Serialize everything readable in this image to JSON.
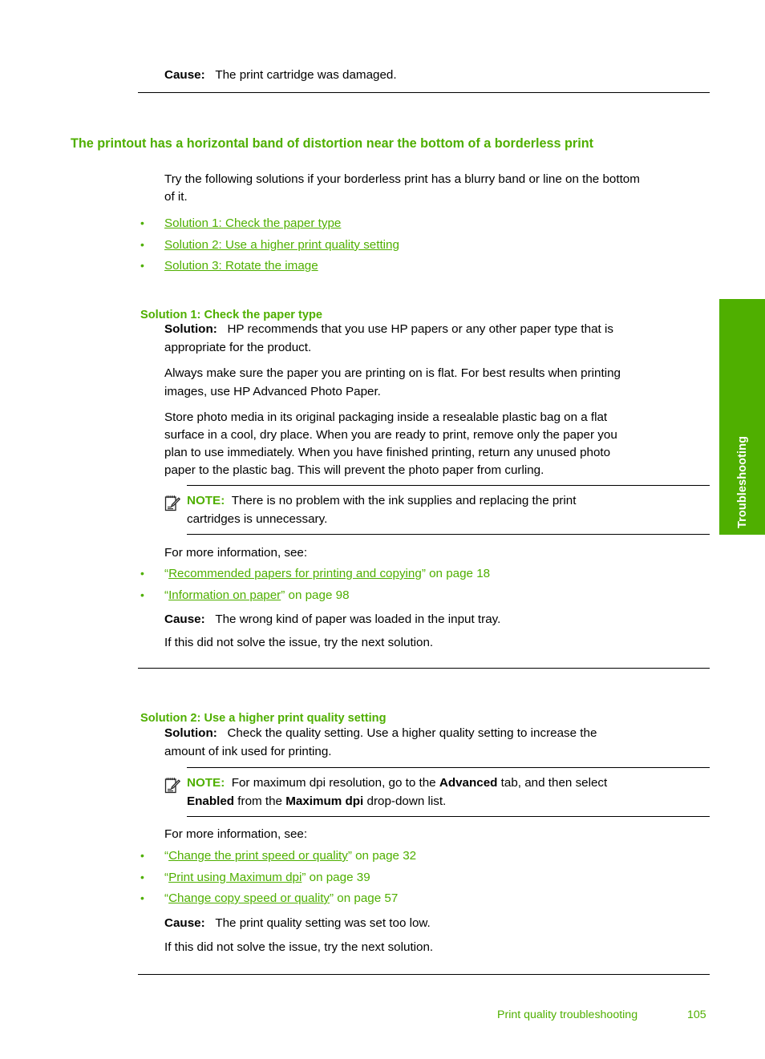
{
  "colors": {
    "brand_green": "#4FAF00",
    "text": "#000000",
    "tab_background": "#4FAF00",
    "tab_text": "#FFFFFF"
  },
  "side_tab": {
    "label": "Troubleshooting"
  },
  "top_cause": {
    "label": "Cause:",
    "text": "The print cartridge was damaged."
  },
  "main_heading": "The printout has a horizontal band of distortion near the bottom of a borderless print",
  "intro": {
    "line1": "Try the following solutions if your borderless print has a blurry band or line on the bottom",
    "line2": "of it."
  },
  "solution_links": [
    {
      "label": "Solution 1: Check the paper type"
    },
    {
      "label": "Solution 2: Use a higher print quality setting"
    },
    {
      "label": "Solution 3: Rotate the image"
    }
  ],
  "solution1": {
    "heading": "Solution 1: Check the paper type",
    "solution_label": "Solution:",
    "solution_text_line1": "HP recommends that you use HP papers or any other paper type that is",
    "solution_text_line2": "appropriate for the product.",
    "para2_line1": "Always make sure the paper you are printing on is flat. For best results when printing",
    "para2_line2": "images, use HP Advanced Photo Paper.",
    "para3_line1": "Store photo media in its original packaging inside a resealable plastic bag on a flat",
    "para3_line2": "surface in a cool, dry place. When you are ready to print, remove only the paper you",
    "para3_line3": "plan to use immediately. When you have finished printing, return any unused photo",
    "para3_line4": "paper to the plastic bag. This will prevent the photo paper from curling.",
    "note": {
      "icon": "note-pencil-icon",
      "label": "NOTE:",
      "text_line1": "There is no problem with the ink supplies and replacing the print",
      "text_line2": "cartridges is unnecessary."
    },
    "more_info_label": "For more information, see:",
    "more_info_links": [
      {
        "quote_open": "“",
        "link": "Recommended papers for printing and copying",
        "quote_close": "”",
        "suffix": " on page 18"
      },
      {
        "quote_open": "“",
        "link": "Information on paper",
        "quote_close": "”",
        "suffix": " on page 98"
      }
    ],
    "cause_label": "Cause:",
    "cause_text": "The wrong kind of paper was loaded in the input tray.",
    "next_step": "If this did not solve the issue, try the next solution."
  },
  "solution2": {
    "heading": "Solution 2: Use a higher print quality setting",
    "solution_label": "Solution:",
    "solution_text_line1": "Check the quality setting. Use a higher quality setting to increase the",
    "solution_text_line2": "amount of ink used for printing.",
    "note": {
      "icon": "note-pencil-icon",
      "label": "NOTE:",
      "line1_a": "For maximum dpi resolution, go to the ",
      "line1_b": "Advanced",
      "line1_c": " tab, and then select",
      "line2_a": "Enabled",
      "line2_b": " from the ",
      "line2_c": "Maximum dpi",
      "line2_d": " drop-down list."
    },
    "more_info_label": "For more information, see:",
    "more_info_links": [
      {
        "quote_open": "“",
        "link": "Change the print speed or quality",
        "quote_close": "”",
        "suffix": " on page 32"
      },
      {
        "quote_open": "“",
        "link": "Print using Maximum dpi",
        "quote_close": "”",
        "suffix": " on page 39"
      },
      {
        "quote_open": "“",
        "link": "Change copy speed or quality",
        "quote_close": "”",
        "suffix": " on page 57"
      }
    ],
    "cause_label": "Cause:",
    "cause_text": "The print quality setting was set too low.",
    "next_step": "If this did not solve the issue, try the next solution."
  },
  "footer": {
    "section": "Print quality troubleshooting",
    "page_number": "105"
  }
}
